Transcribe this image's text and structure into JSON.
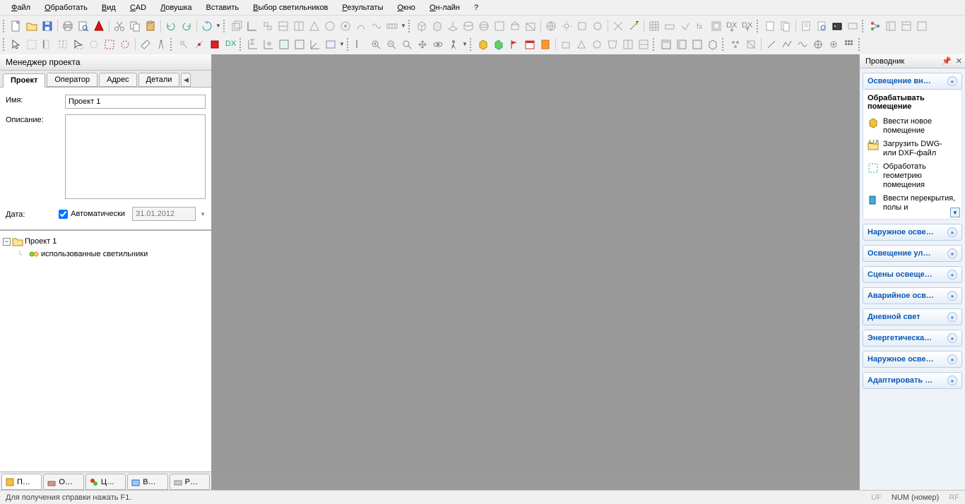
{
  "menu": {
    "items": [
      "Файл",
      "Обработать",
      "Вид",
      "CAD",
      "Ловушка",
      "Вставить",
      "Выбор светильников",
      "Результаты",
      "Окно",
      "Он-лайн",
      "?"
    ],
    "mnemonics": [
      "Ф",
      "О",
      "В",
      "C",
      "Л",
      "",
      "В",
      "Р",
      "О",
      "О",
      ""
    ]
  },
  "left_panel": {
    "title": "Менеджер проекта",
    "tabs": [
      "Проект",
      "Оператор",
      "Адрес",
      "Детали"
    ],
    "name_label": "Имя:",
    "name_value": "Проект 1",
    "desc_label": "Описание:",
    "desc_value": "",
    "date_label": "Дата:",
    "auto_label": "Автоматически",
    "date_value": "31.01.2012",
    "tree_root": "Проект 1",
    "tree_child": "использованные светильники",
    "bottom_tabs": [
      "П…",
      "О…",
      "Ц…",
      "В…",
      "Р…"
    ]
  },
  "right_panel": {
    "title": "Проводник",
    "sections": [
      {
        "label": "Освещение вн…",
        "expanded": true
      },
      {
        "label": "Наружное осве…"
      },
      {
        "label": "Освещение ул…"
      },
      {
        "label": "Сцены освеще…"
      },
      {
        "label": "Аварийное осв…"
      },
      {
        "label": "Дневной свет"
      },
      {
        "label": "Энергетическа…"
      },
      {
        "label": "Наружное осве…"
      },
      {
        "label": "Адаптировать …"
      }
    ],
    "section0": {
      "subtitle": "Обрабатывать помещение",
      "items": [
        "Ввести новое помещение",
        "Загрузить DWG- или DXF-файл",
        "Обработать геометрию помещения",
        "Ввести перекрытия, полы и"
      ]
    }
  },
  "status": {
    "help": "Для получения справки нажать F1.",
    "uf": "UF",
    "num": "NUM (номер)",
    "rf": "RF"
  }
}
